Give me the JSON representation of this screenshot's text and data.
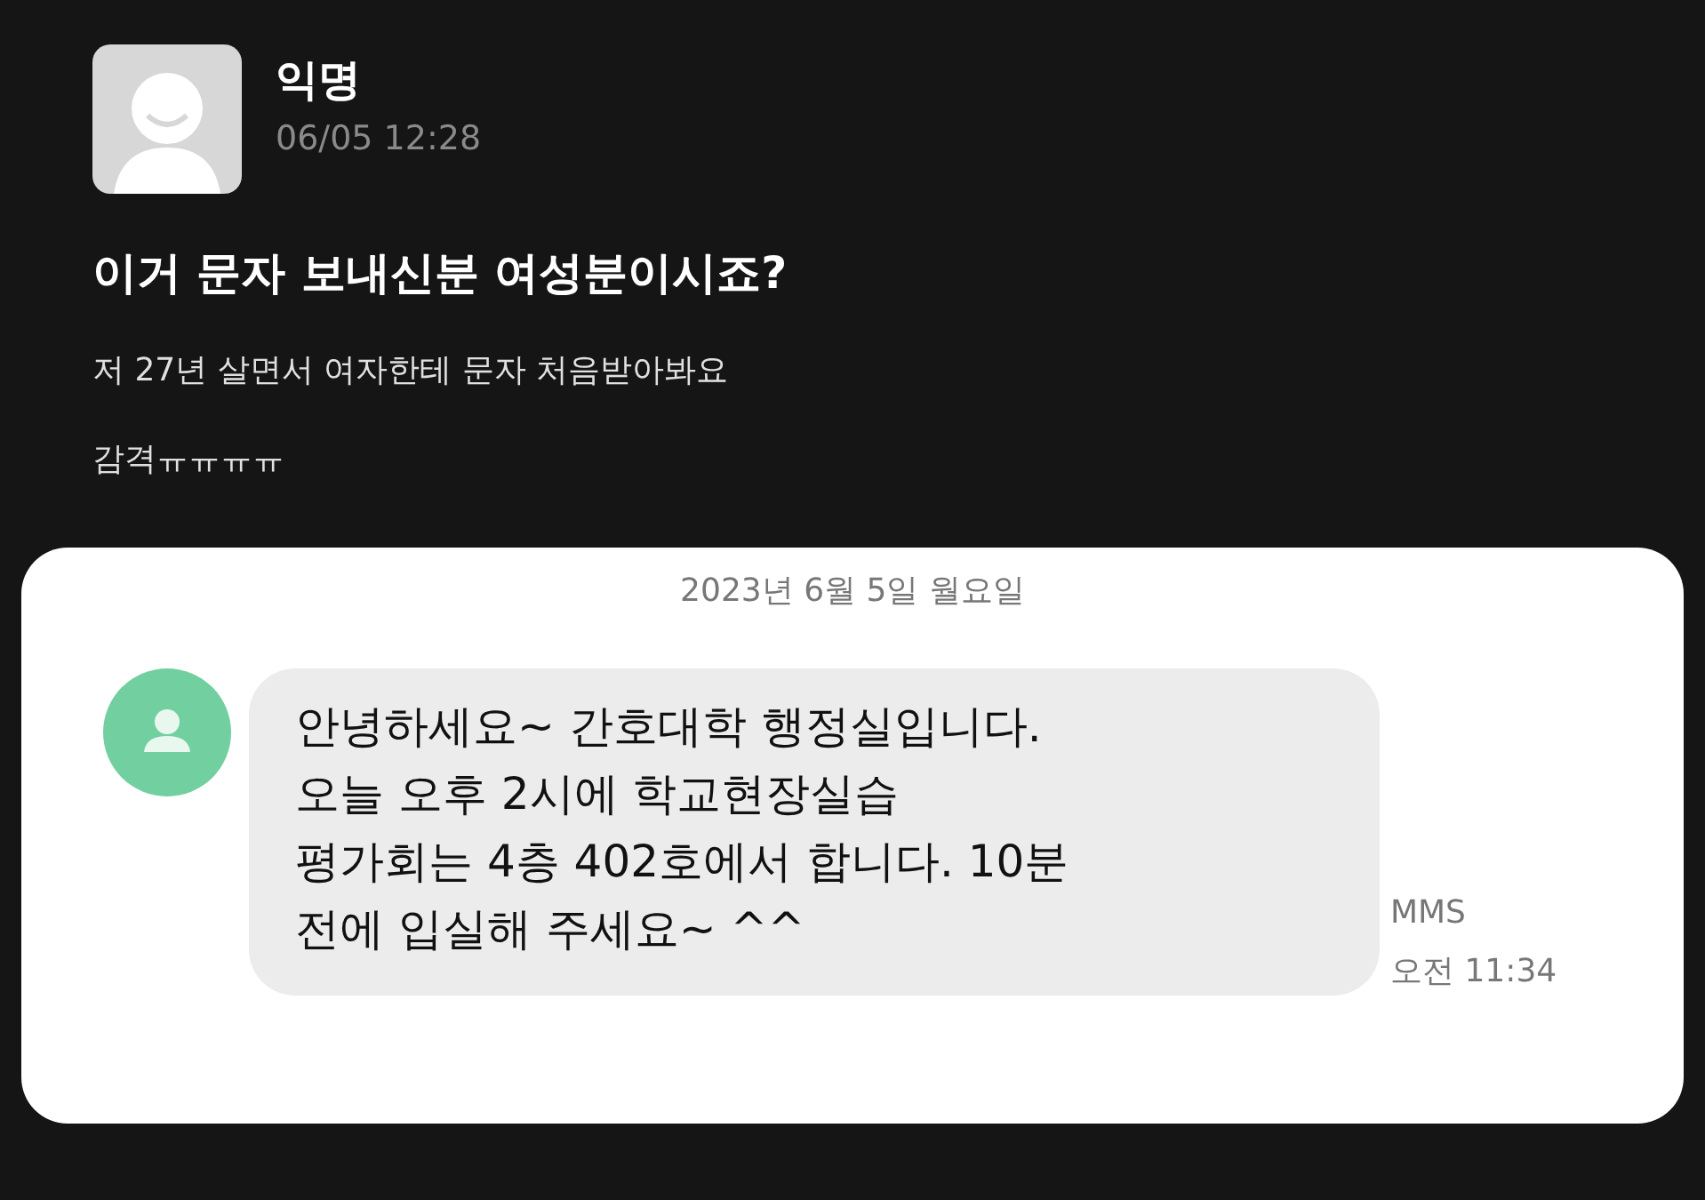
{
  "post": {
    "author": "익명",
    "timestamp": "06/05 12:28",
    "title": "이거 문자 보내신분 여성분이시죠?",
    "body": [
      "저 27년 살면서 여자한테 문자 처음받아봐요",
      "감격ㅠㅠㅠㅠ"
    ]
  },
  "message_screenshot": {
    "date_header": "2023년 6월 5일 월요일",
    "message": {
      "lines": [
        "안녕하세요~ 간호대학 행정실입니다.",
        "오늘 오후 2시에 학교현장실습",
        "평가회는 4층 402호에서 합니다. 10분",
        "전에 입실해 주세요~ ^^"
      ],
      "type": "MMS",
      "time": "오전 11:34"
    }
  }
}
